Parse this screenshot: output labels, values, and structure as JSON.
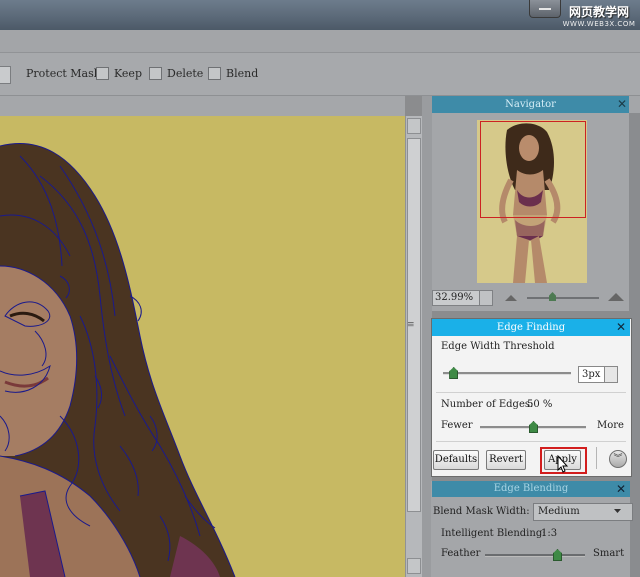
{
  "window": {
    "watermark_main": "网页教学网",
    "watermark_sub": "WWW.WEB3X.COM"
  },
  "toolbar": {
    "protect_mask_label": "Protect Mask:",
    "keep_label": "Keep",
    "delete_label": "Delete",
    "blend_label": "Blend"
  },
  "navigator": {
    "title": "Navigator",
    "zoom": "32.99%"
  },
  "edge_finding": {
    "title": "Edge Finding",
    "threshold_label": "Edge Width Threshold",
    "threshold_value": "3px",
    "threshold_level": 0.08,
    "edges_label": "Number of Edges:",
    "edges_value": "50 %",
    "edges_level": 0.5,
    "fewer_label": "Fewer",
    "more_label": "More",
    "defaults_label": "Defaults",
    "revert_label": "Revert",
    "apply_label": "Apply"
  },
  "edge_blending": {
    "title": "Edge Blending",
    "mask_width_label": "Blend Mask Width:",
    "mask_width_value": "Medium",
    "intelligent_label": "Intelligent Blending:",
    "intelligent_value": "1:3",
    "feather_label": "Feather",
    "smart_label": "Smart",
    "feather_level": 0.72
  },
  "colors": {
    "canvas_bg": "#c7b963",
    "panel_head": "#3e8ba8",
    "active_head": "#1ab0e8",
    "edge_lines": "#1a1a8c",
    "highlight": "#d21d1d"
  }
}
